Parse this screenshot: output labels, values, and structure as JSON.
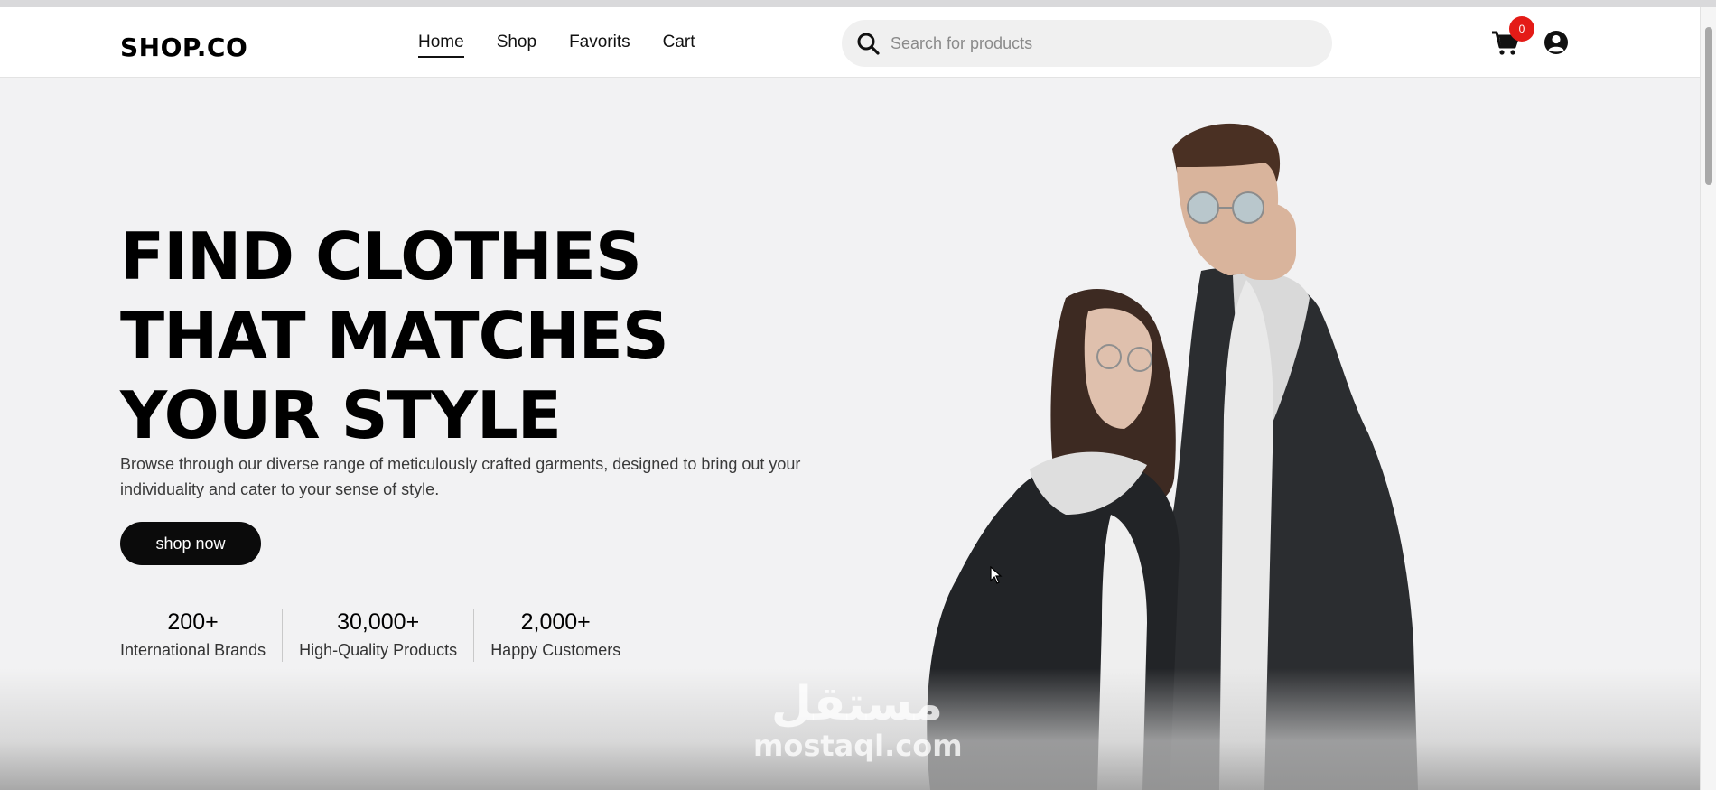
{
  "header": {
    "logo": "SHOP.CO",
    "nav": [
      {
        "label": "Home",
        "active": true
      },
      {
        "label": "Shop",
        "active": false
      },
      {
        "label": "Favorits",
        "active": false
      },
      {
        "label": "Cart",
        "active": false
      }
    ],
    "search_placeholder": "Search for products",
    "cart_count": "0",
    "icons": {
      "search": "search-icon",
      "cart": "cart-icon",
      "user": "user-icon"
    },
    "badge_color": "#e41b17"
  },
  "hero": {
    "title_lines": [
      "FIND CLOTHES",
      "THAT MATCHES",
      "YOUR STYLE"
    ],
    "description": "Browse through our diverse range of meticulously crafted garments, designed to bring out your individuality and cater to your sense of style.",
    "button_label": "shop now",
    "stats": [
      {
        "value": "200+",
        "label": "International Brands"
      },
      {
        "value": "30,000+",
        "label": "High-Quality Products"
      },
      {
        "value": "2,000+",
        "label": "Happy Customers"
      }
    ]
  },
  "watermark": {
    "arabic": "مستقل",
    "latin": "mostaql.com"
  },
  "colors": {
    "page_bg": "#f2f2f3",
    "primary": "#000000",
    "button_bg": "#0b0b0b"
  }
}
